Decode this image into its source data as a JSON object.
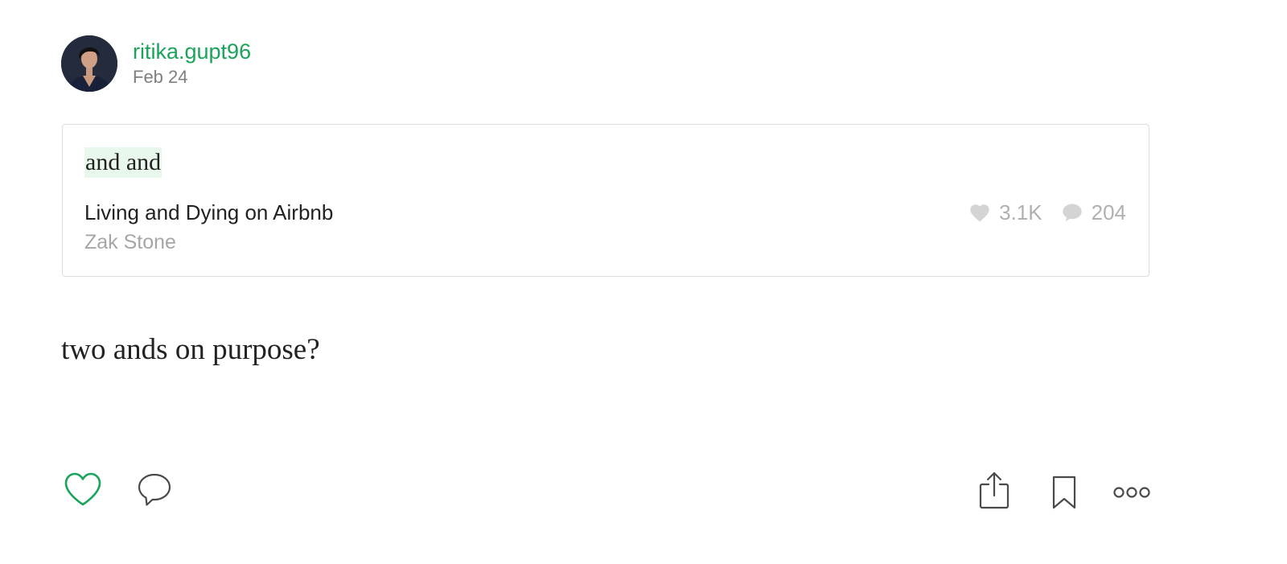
{
  "author": {
    "name": "ritika.gupt96",
    "date": "Feb 24",
    "avatar_icon": "user-avatar"
  },
  "quote_card": {
    "highlight": "and and",
    "story_title": "Living and Dying on Airbnb",
    "story_author": "Zak Stone",
    "likes": "3.1K",
    "responses": "204"
  },
  "response": {
    "text": "two ands on purpose?"
  },
  "actions": {
    "like_icon": "heart-icon",
    "comment_icon": "comment-icon",
    "share_icon": "share-icon",
    "bookmark_icon": "bookmark-icon",
    "more_icon": "more-icon"
  },
  "colors": {
    "accent": "#1aa35a",
    "highlight_bg": "#e8f8ec",
    "muted": "#b0b0b0"
  }
}
